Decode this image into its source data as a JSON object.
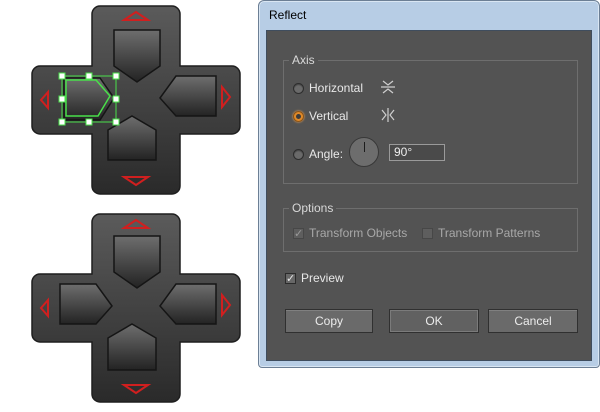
{
  "dialog": {
    "title": "Reflect",
    "axis": {
      "legend": "Axis",
      "horizontal": "Horizontal",
      "vertical": "Vertical",
      "angle_label": "Angle:",
      "angle_value": "90°",
      "selected": "vertical"
    },
    "options": {
      "legend": "Options",
      "transform_objects": "Transform Objects",
      "transform_patterns": "Transform Patterns",
      "transform_objects_checked": true,
      "transform_patterns_checked": false
    },
    "preview": {
      "label": "Preview",
      "checked": true
    },
    "buttons": {
      "copy": "Copy",
      "ok": "OK",
      "cancel": "Cancel"
    }
  },
  "icons": {
    "horizontal_icon": "reflect-horizontal-icon",
    "vertical_icon": "reflect-vertical-icon"
  },
  "colors": {
    "arrow_red": "#d01f1f",
    "selection_green": "#49e04a",
    "dialog_bg": "#535353",
    "frame": "#b7cde5"
  }
}
